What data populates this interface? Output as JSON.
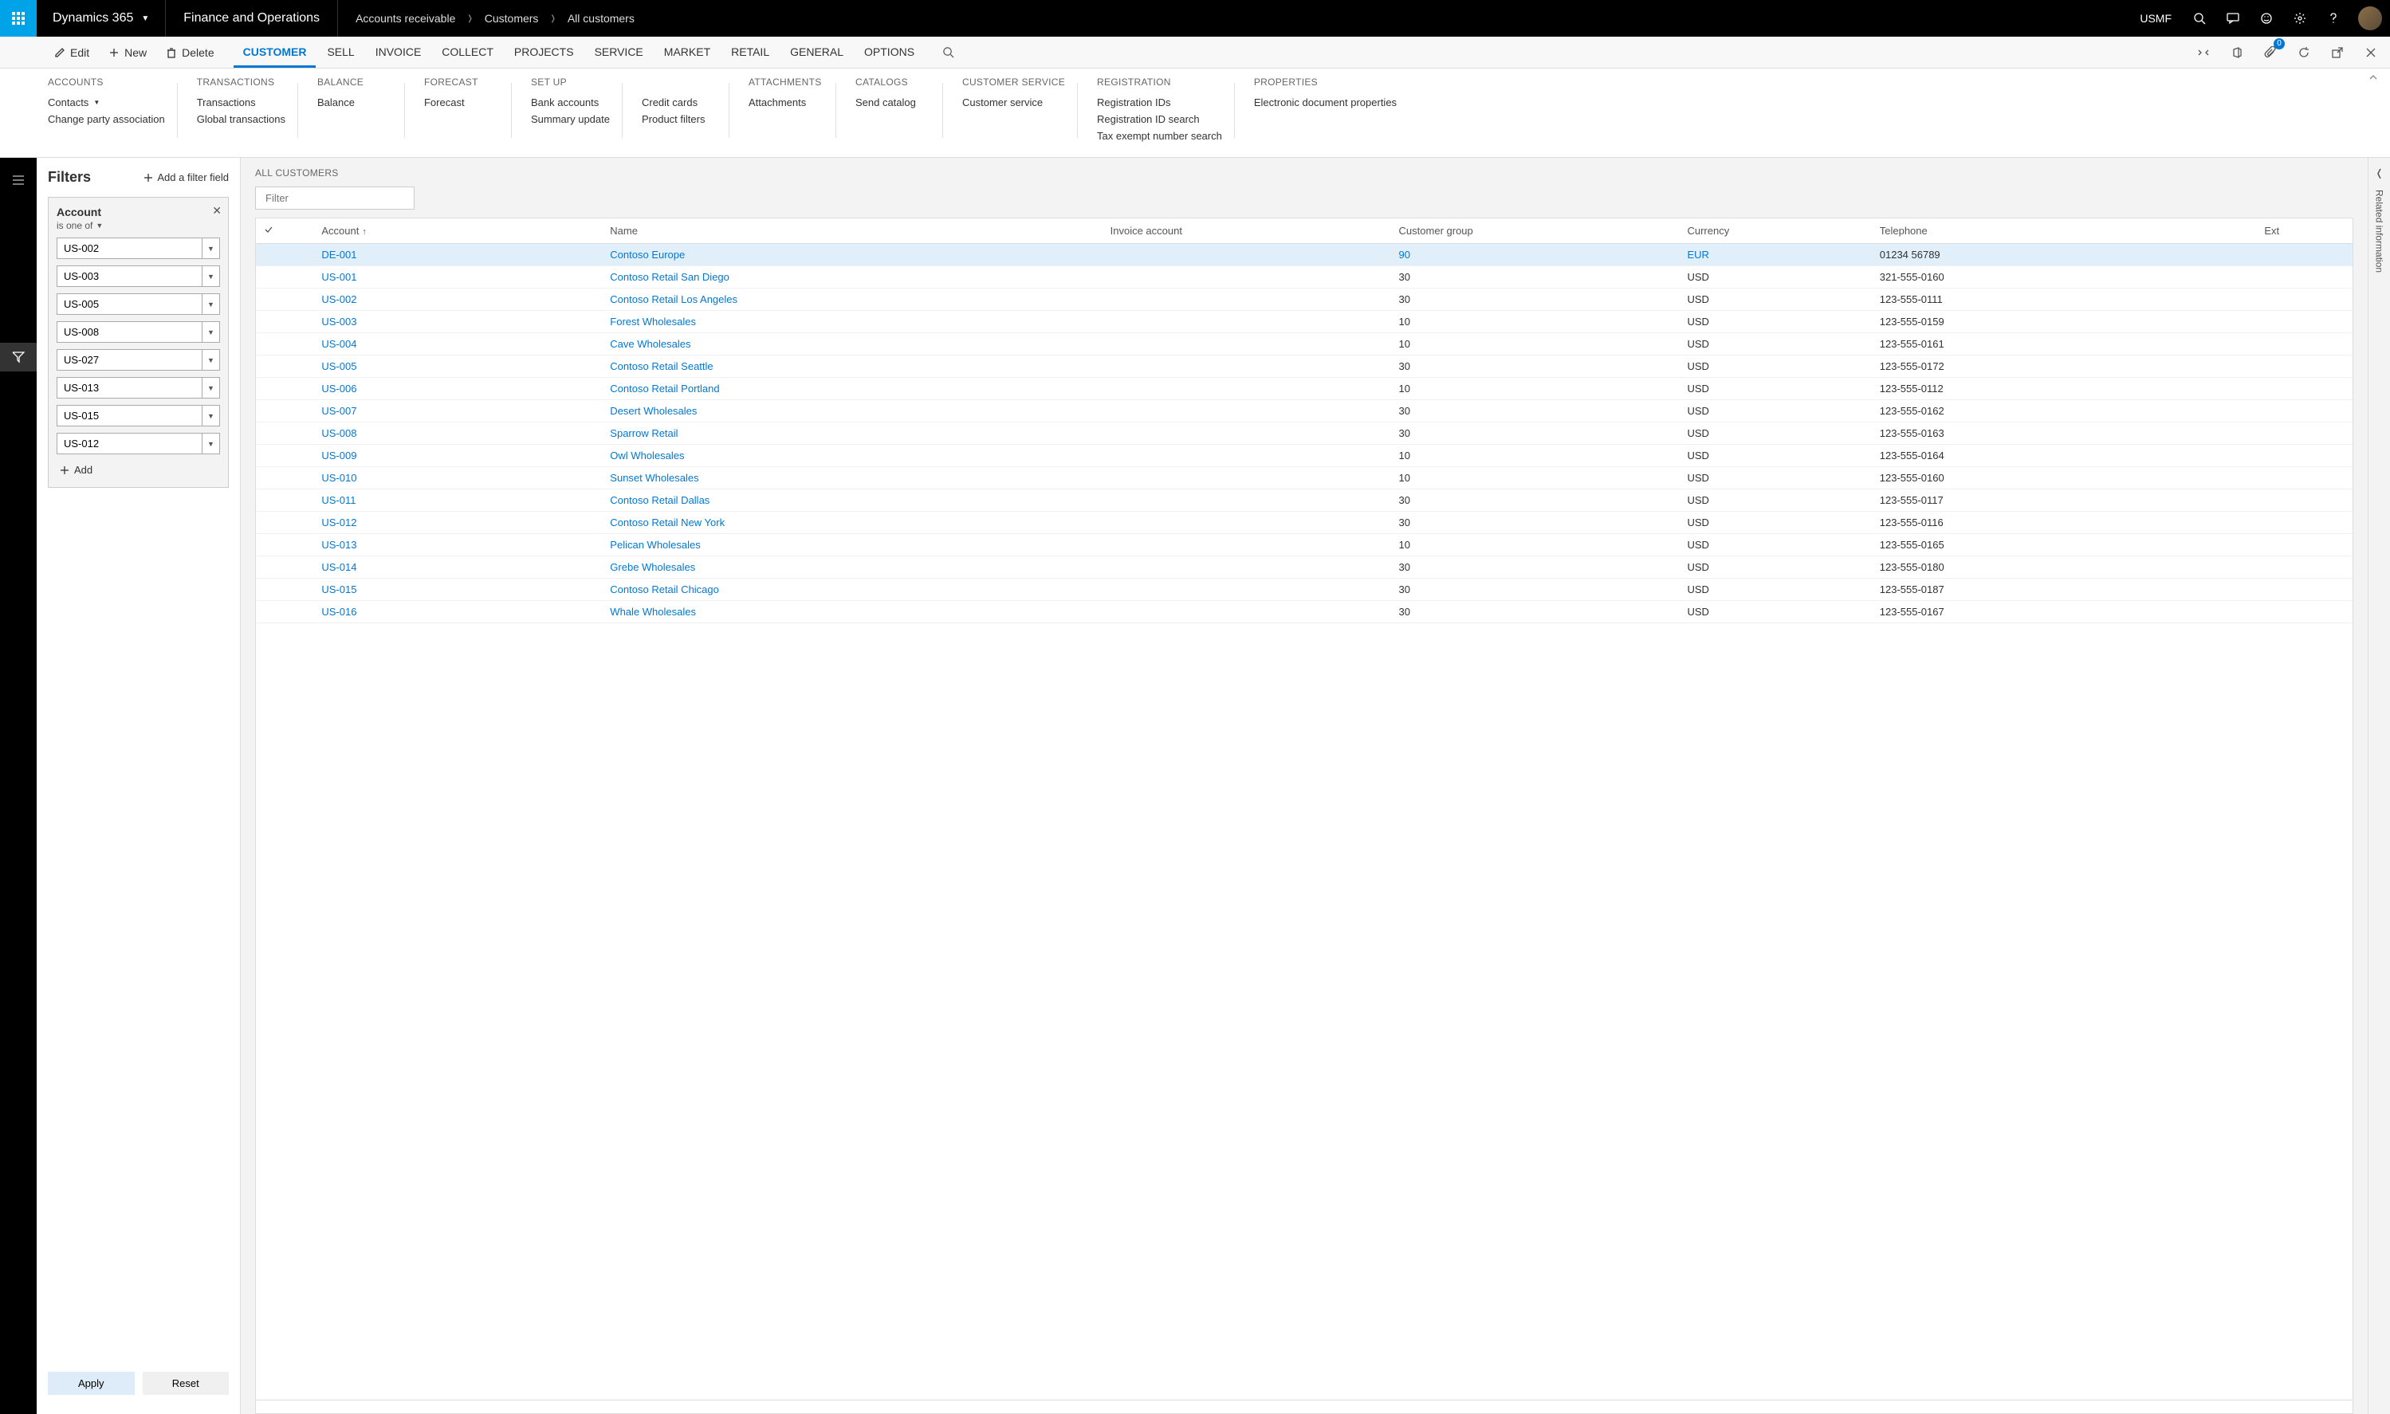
{
  "header": {
    "product": "Dynamics 365",
    "app": "Finance and Operations",
    "breadcrumb": [
      "Accounts receivable",
      "Customers",
      "All customers"
    ],
    "entity": "USMF"
  },
  "commandbar": {
    "edit": "Edit",
    "new": "New",
    "delete": "Delete",
    "tabs": [
      "CUSTOMER",
      "SELL",
      "INVOICE",
      "COLLECT",
      "PROJECTS",
      "SERVICE",
      "MARKET",
      "RETAIL",
      "GENERAL",
      "OPTIONS"
    ],
    "active_tab": "CUSTOMER",
    "badge_count": "0"
  },
  "ribbon": {
    "groups": [
      {
        "title": "ACCOUNTS",
        "items": [
          "Contacts",
          "Change party association"
        ],
        "item_chevron": [
          true,
          false
        ]
      },
      {
        "title": "TRANSACTIONS",
        "items": [
          "Transactions",
          "Global transactions"
        ]
      },
      {
        "title": "BALANCE",
        "items": [
          "Balance"
        ]
      },
      {
        "title": "FORECAST",
        "items": [
          "Forecast"
        ]
      },
      {
        "title": "SET UP",
        "items": [
          "Bank accounts",
          "Summary update"
        ]
      },
      {
        "title": "",
        "items": [
          "Credit cards",
          "Product filters"
        ]
      },
      {
        "title": "ATTACHMENTS",
        "items": [
          "Attachments"
        ]
      },
      {
        "title": "CATALOGS",
        "items": [
          "Send catalog"
        ]
      },
      {
        "title": "CUSTOMER SERVICE",
        "items": [
          "Customer service"
        ]
      },
      {
        "title": "REGISTRATION",
        "items": [
          "Registration IDs",
          "Registration ID search",
          "Tax exempt number search"
        ]
      },
      {
        "title": "PROPERTIES",
        "items": [
          "Electronic document properties"
        ]
      }
    ]
  },
  "filters": {
    "title": "Filters",
    "add_field_label": "Add a filter field",
    "block_name": "Account",
    "operator": "is one of",
    "values": [
      "US-002",
      "US-003",
      "US-005",
      "US-008",
      "US-027",
      "US-013",
      "US-015",
      "US-012"
    ],
    "add_label": "Add",
    "apply": "Apply",
    "reset": "Reset"
  },
  "grid": {
    "title": "ALL CUSTOMERS",
    "filter_placeholder": "Filter",
    "columns": [
      "",
      "Account",
      "Name",
      "Invoice account",
      "Customer group",
      "Currency",
      "Telephone",
      "Ext"
    ],
    "sort_col": "Account",
    "rows": [
      {
        "account": "DE-001",
        "name": "Contoso Europe",
        "inv": "",
        "group": "90",
        "curr": "EUR",
        "tel": "01234 56789",
        "selected": true
      },
      {
        "account": "US-001",
        "name": "Contoso Retail San Diego",
        "inv": "",
        "group": "30",
        "curr": "USD",
        "tel": "321-555-0160"
      },
      {
        "account": "US-002",
        "name": "Contoso Retail Los Angeles",
        "inv": "",
        "group": "30",
        "curr": "USD",
        "tel": "123-555-0111"
      },
      {
        "account": "US-003",
        "name": "Forest Wholesales",
        "inv": "",
        "group": "10",
        "curr": "USD",
        "tel": "123-555-0159"
      },
      {
        "account": "US-004",
        "name": "Cave Wholesales",
        "inv": "",
        "group": "10",
        "curr": "USD",
        "tel": "123-555-0161"
      },
      {
        "account": "US-005",
        "name": "Contoso Retail Seattle",
        "inv": "",
        "group": "30",
        "curr": "USD",
        "tel": "123-555-0172"
      },
      {
        "account": "US-006",
        "name": "Contoso Retail Portland",
        "inv": "",
        "group": "10",
        "curr": "USD",
        "tel": "123-555-0112"
      },
      {
        "account": "US-007",
        "name": "Desert Wholesales",
        "inv": "",
        "group": "30",
        "curr": "USD",
        "tel": "123-555-0162"
      },
      {
        "account": "US-008",
        "name": "Sparrow Retail",
        "inv": "",
        "group": "30",
        "curr": "USD",
        "tel": "123-555-0163"
      },
      {
        "account": "US-009",
        "name": "Owl Wholesales",
        "inv": "",
        "group": "10",
        "curr": "USD",
        "tel": "123-555-0164"
      },
      {
        "account": "US-010",
        "name": "Sunset Wholesales",
        "inv": "",
        "group": "10",
        "curr": "USD",
        "tel": "123-555-0160"
      },
      {
        "account": "US-011",
        "name": "Contoso Retail Dallas",
        "inv": "",
        "group": "30",
        "curr": "USD",
        "tel": "123-555-0117"
      },
      {
        "account": "US-012",
        "name": "Contoso Retail New York",
        "inv": "",
        "group": "30",
        "curr": "USD",
        "tel": "123-555-0116"
      },
      {
        "account": "US-013",
        "name": "Pelican Wholesales",
        "inv": "",
        "group": "10",
        "curr": "USD",
        "tel": "123-555-0165"
      },
      {
        "account": "US-014",
        "name": "Grebe Wholesales",
        "inv": "",
        "group": "30",
        "curr": "USD",
        "tel": "123-555-0180"
      },
      {
        "account": "US-015",
        "name": "Contoso Retail Chicago",
        "inv": "",
        "group": "30",
        "curr": "USD",
        "tel": "123-555-0187"
      },
      {
        "account": "US-016",
        "name": "Whale Wholesales",
        "inv": "",
        "group": "30",
        "curr": "USD",
        "tel": "123-555-0167"
      }
    ]
  },
  "related_panel": "Related information"
}
